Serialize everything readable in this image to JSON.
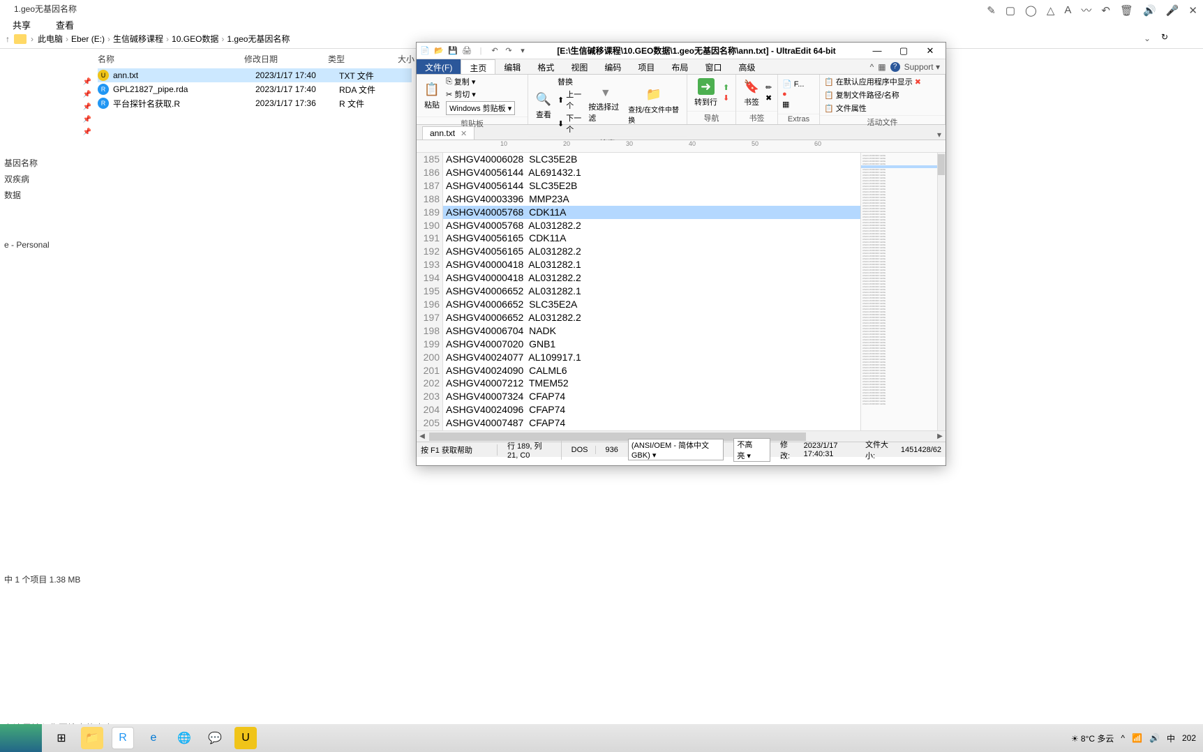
{
  "explorer": {
    "title": "1.geo无基因名称",
    "tabs": [
      "共享",
      "查看"
    ],
    "breadcrumb": [
      "此电脑",
      "Eber (E:)",
      "生信碱移课程",
      "10.GEO数据",
      "1.geo无基因名称"
    ],
    "columns": {
      "name": "名称",
      "date": "修改日期",
      "type": "类型",
      "size": "大小"
    },
    "files": [
      {
        "name": "ann.txt",
        "date": "2023/1/17 17:40",
        "type": "TXT 文件",
        "icon": "yellow",
        "iconChar": "U",
        "selected": true
      },
      {
        "name": "GPL21827_pipe.rda",
        "date": "2023/1/17 17:40",
        "type": "RDA 文件",
        "icon": "blue",
        "iconChar": "R",
        "selected": false
      },
      {
        "name": "平台探针名获取.R",
        "date": "2023/1/17 17:36",
        "type": "R 文件",
        "icon": "blue",
        "iconChar": "R",
        "selected": false
      }
    ],
    "sidebar": [
      "基因名称",
      "双疾病",
      "数据",
      "",
      "e - Personal"
    ],
    "status": "中 1 个项目  1.38 MB",
    "search_hint": "在这里输入你要搜索的内容"
  },
  "ultraedit": {
    "title": "[E:\\生信碱移课程\\10.GEO数据\\1.geo无基因名称\\ann.txt] - UltraEdit 64-bit",
    "menus": [
      "文件(F)",
      "主页",
      "编辑",
      "格式",
      "视图",
      "编码",
      "项目",
      "布局",
      "窗口",
      "高级"
    ],
    "support": "Support ▾",
    "ribbon": {
      "clipboard": {
        "paste": "粘贴",
        "copy": "复制",
        "cut": "剪切",
        "combo": "Windows 剪贴板",
        "label": "剪贴板"
      },
      "search": {
        "find": "查看",
        "replace": "替换",
        "prev": "上一个",
        "next": "下一个",
        "filter": "按选择过滤",
        "find_in": "查找/在文件中替换",
        "label": "搜索"
      },
      "nav": {
        "goto": "转到行",
        "label": "导航"
      },
      "bookmark": {
        "bm": "书签",
        "label": "书签"
      },
      "extras": {
        "f": "F...",
        "label": "Extras"
      },
      "active": {
        "show_default": "在默认应用程序中显示",
        "copy_path": "复制文件路径/名称",
        "props": "文件属性",
        "label": "活动文件"
      }
    },
    "tab": "ann.txt",
    "ruler_marks": [
      "10",
      "20",
      "30",
      "40",
      "50",
      "60"
    ],
    "lines": [
      {
        "n": 185,
        "t": "ASHGV40006028  SLC35E2B"
      },
      {
        "n": 186,
        "t": "ASHGV40056144  AL691432.1"
      },
      {
        "n": 187,
        "t": "ASHGV40056144  SLC35E2B"
      },
      {
        "n": 188,
        "t": "ASHGV40003396  MMP23A"
      },
      {
        "n": 189,
        "t": "ASHGV40005768  CDK11A",
        "sel": true
      },
      {
        "n": 190,
        "t": "ASHGV40005768  AL031282.2"
      },
      {
        "n": 191,
        "t": "ASHGV40056165  CDK11A"
      },
      {
        "n": 192,
        "t": "ASHGV40056165  AL031282.2"
      },
      {
        "n": 193,
        "t": "ASHGV40000418  AL031282.1"
      },
      {
        "n": 194,
        "t": "ASHGV40000418  AL031282.2"
      },
      {
        "n": 195,
        "t": "ASHGV40006652  AL031282.1"
      },
      {
        "n": 196,
        "t": "ASHGV40006652  SLC35E2A"
      },
      {
        "n": 197,
        "t": "ASHGV40006652  AL031282.2"
      },
      {
        "n": 198,
        "t": "ASHGV40006704  NADK"
      },
      {
        "n": 199,
        "t": "ASHGV40007020  GNB1"
      },
      {
        "n": 200,
        "t": "ASHGV40024077  AL109917.1"
      },
      {
        "n": 201,
        "t": "ASHGV40024090  CALML6"
      },
      {
        "n": 202,
        "t": "ASHGV40007212  TMEM52"
      },
      {
        "n": 203,
        "t": "ASHGV40007324  CFAP74"
      },
      {
        "n": 204,
        "t": "ASHGV40024096  CFAP74"
      },
      {
        "n": 205,
        "t": "ASHGV40007487  CFAP74"
      }
    ],
    "status": {
      "help": "按 F1 获取帮助",
      "pos": "行 189, 列 21, C0",
      "eol": "DOS",
      "cp": "936",
      "enc": "(ANSI/OEM - 简体中文 GBK)",
      "hl": "不高亮",
      "mod": "修改:",
      "mod_date": "2023/1/17 17:40:31",
      "size_lbl": "文件大小:",
      "size": "1451428/62"
    }
  },
  "taskbar": {
    "weather": "8°C 多云",
    "ime": "中",
    "year": "202"
  }
}
